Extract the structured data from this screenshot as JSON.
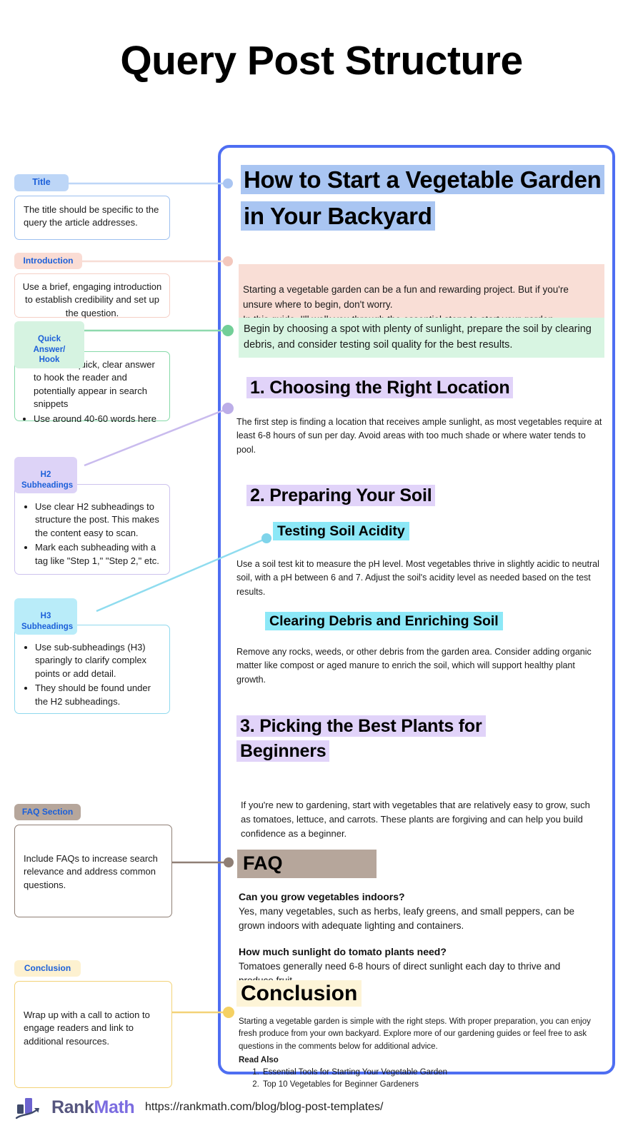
{
  "page": {
    "title": "Query Post Structure"
  },
  "annotations": [
    {
      "id": "title",
      "tag": "Title",
      "tag_bg": "#bdd6f7",
      "border": "#9dc0ef",
      "dot": "#a9c5f2",
      "note": "The title should be specific to the query the article addresses.",
      "align": "left"
    },
    {
      "id": "introduction",
      "tag": "Introduction",
      "tag_bg": "#fadcd4",
      "border": "#f5cfc5",
      "dot": "#f3c8bd",
      "note": "Use a brief, engaging introduction to establish credibility and set up the question.",
      "align": "center"
    },
    {
      "id": "quick-answer",
      "tag": "Quick Answer/\nHook",
      "tag_bg": "#d6f3e1",
      "border": "#86d9a8",
      "dot": "#72cf98",
      "bullets": [
        "Provide a quick, clear answer to hook the reader and potentially appear in search snippets",
        "Use around 40-60 words here"
      ]
    },
    {
      "id": "h2-subheadings",
      "tag": "H2\nSubheadings",
      "tag_bg": "#ddd3f7",
      "border": "#cdc2ee",
      "dot": "#bcaee8",
      "bullets": [
        "Use clear H2 subheadings to structure the post. This makes the content easy to scan.",
        "Mark each subheading with a tag like \"Step 1,\" \"Step 2,\" etc."
      ]
    },
    {
      "id": "h3-subheadings",
      "tag": "H3\nSubheadings",
      "tag_bg": "#b9ecf9",
      "border": "#8fd9ee",
      "dot": "#7fd4ea",
      "bullets": [
        "Use sub-subheadings (H3) sparingly to clarify complex points or add detail.",
        "They should be found under the H2 subheadings."
      ]
    },
    {
      "id": "faq-section",
      "tag": "FAQ Section",
      "tag_bg": "#b6a69b",
      "border": "#8f7f75",
      "dot": "#8f7f75",
      "note": "Include FAQs to increase search relevance and address common questions.",
      "align": "left"
    },
    {
      "id": "conclusion",
      "tag": "Conclusion",
      "tag_bg": "#fdf1d0",
      "border": "#f3d277",
      "dot": "#f5d163",
      "note": "Wrap up with a call to action to engage readers and link to additional resources.",
      "align": "left"
    }
  ],
  "preview": {
    "border_color": "#4e6ef2",
    "title": "How to Start a Vegetable Garden in Your Backyard",
    "title_highlight": "#a9c5f2",
    "intro": "Starting a vegetable garden can be a fun and rewarding project. But if you're unsure where to begin, don't worry.\nIn this guide, I'll walk you through the essential steps to start your garden.",
    "intro_highlight": "#f9ded6",
    "quick_answer": "Begin by choosing a spot with plenty of sunlight, prepare the soil by clearing debris, and consider testing soil quality for the best results.",
    "quick_answer_highlight": "#d8f5e2",
    "h2_highlight": "#e1d3f9",
    "h3_highlight": "#8ce8f7",
    "sections": [
      {
        "heading": "1. Choosing the Right Location",
        "body": "The first step is finding a location that receives ample sunlight, as most vegetables require at least 6-8 hours of sun per day. Avoid areas with too much shade or where water tends to pool."
      },
      {
        "heading": "2. Preparing Your Soil",
        "subsections": [
          {
            "heading": "Testing Soil Acidity",
            "body": "Use a soil test kit to measure the pH level. Most vegetables thrive in slightly acidic to neutral soil, with a pH between 6 and 7. Adjust the soil's acidity level as needed based on the test results."
          },
          {
            "heading": "Clearing Debris and Enriching Soil",
            "body": "Remove any rocks, weeds, or other debris from the garden area. Consider adding organic matter like compost or aged manure to enrich the soil, which will support healthy plant growth."
          }
        ]
      },
      {
        "heading": "3. Picking the Best Plants for Beginners",
        "body": "If you're new to gardening, start with vegetables that are relatively easy to grow, such as tomatoes, lettuce, and carrots. These plants are forgiving and can help you build confidence as a beginner."
      }
    ],
    "faq": {
      "heading": "FAQ",
      "heading_highlight": "#b6a69b",
      "items": [
        {
          "question": "Can you grow vegetables indoors?",
          "answer": "Yes, many vegetables, such as herbs, leafy greens, and small peppers, can be grown indoors with adequate lighting and containers."
        },
        {
          "question": "How much sunlight do tomato plants need?",
          "answer": "Tomatoes generally need 6-8 hours of direct sunlight each day to thrive and produce fruit."
        }
      ]
    },
    "conclusion": {
      "heading": "Conclusion",
      "heading_highlight": "#fdf4d7",
      "body": "Starting a vegetable garden is simple with the right steps. With proper preparation, you can enjoy fresh produce from your own backyard. Explore more of our gardening guides or feel free to ask questions in the comments below for additional advice.",
      "read_also_label": "Read Also",
      "read_also": [
        "Essential Tools for Starting Your Vegetable Garden",
        "Top 10 Vegetables for Beginner Gardeners"
      ]
    }
  },
  "footer": {
    "logo_rank": "Rank",
    "logo_math": "Math",
    "url": "https://rankmath.com/blog/blog-post-templates/"
  }
}
